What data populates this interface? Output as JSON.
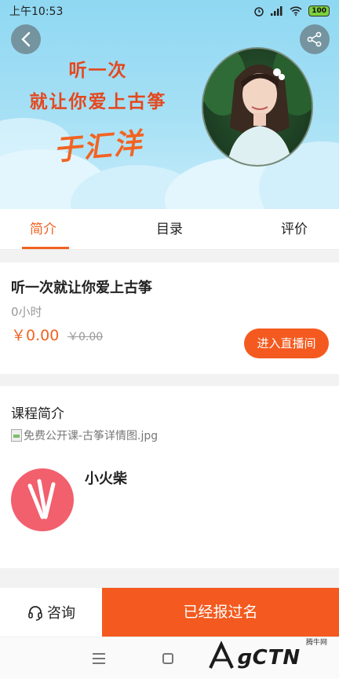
{
  "status_bar": {
    "time": "上午10:53",
    "battery": "100"
  },
  "banner": {
    "headline_line1": "听一次",
    "headline_line2": "就让你爱上古筝",
    "signature": "于汇洋"
  },
  "tabs": [
    {
      "label": "简介",
      "active": true
    },
    {
      "label": "目录",
      "active": false
    },
    {
      "label": "评价",
      "active": false
    }
  ],
  "course": {
    "title": "听一次就让你爱上古筝",
    "duration": "0小时",
    "price": "￥0.00",
    "original_price": "￥0.00",
    "live_button": "进入直播间"
  },
  "intro": {
    "title": "课程简介",
    "image_alt": "免费公开课-古筝详情图.jpg",
    "org_name": "小火柴"
  },
  "bottom_bar": {
    "consult_label": "咨询",
    "signed_label": "已经报过名"
  },
  "watermark": {
    "text": "ɡCTN",
    "small": "腾牛网"
  },
  "colors": {
    "accent": "#f26322",
    "button": "#f45a1f",
    "banner": "#a6e0f5"
  }
}
